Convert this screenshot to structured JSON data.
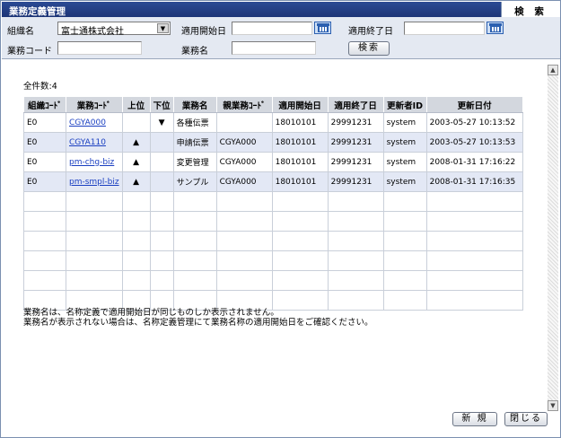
{
  "window": {
    "title": "業務定義管理",
    "tab": "検 索"
  },
  "search": {
    "org_label": "組織名",
    "org_value": "富士通株式会社",
    "start_label": "適用開始日",
    "start_value": "",
    "end_label": "適用終了日",
    "end_value": "",
    "code_label": "業務コード",
    "code_value": "",
    "name_label": "業務名",
    "name_value": "",
    "search_button": "検索"
  },
  "results": {
    "count_text": "全件数:4",
    "columns": [
      "組織ｺｰﾄﾞ",
      "業務ｺｰﾄﾞ",
      "上位",
      "下位",
      "業務名",
      "親業務ｺｰﾄﾞ",
      "適用開始日",
      "適用終了日",
      "更新者ID",
      "更新日付"
    ],
    "rows": [
      {
        "org": "E0",
        "code": "CGYA000",
        "upper": "",
        "lower": "▼",
        "name": "各種伝票",
        "parent": "",
        "start": "18010101",
        "end": "29991231",
        "user": "system",
        "updated": "2003-05-27 10:13:52"
      },
      {
        "org": "E0",
        "code": "CGYA110",
        "upper": "▲",
        "lower": "",
        "name": "申請伝票",
        "parent": "CGYA000",
        "start": "18010101",
        "end": "29991231",
        "user": "system",
        "updated": "2003-05-27 10:13:53"
      },
      {
        "org": "E0",
        "code": "pm-chg-biz",
        "upper": "▲",
        "lower": "",
        "name": "変更管理",
        "parent": "CGYA000",
        "start": "18010101",
        "end": "29991231",
        "user": "system",
        "updated": "2008-01-31 17:16:22"
      },
      {
        "org": "E0",
        "code": "pm-smpl-biz",
        "upper": "▲",
        "lower": "",
        "name": "サンプル",
        "parent": "CGYA000",
        "start": "18010101",
        "end": "29991231",
        "user": "system",
        "updated": "2008-01-31 17:16:35"
      }
    ],
    "empty_rows": 6,
    "note_line1": "業務名は、名称定義で適用開始日が同じものしか表示されません。",
    "note_line2": "業務名が表示されない場合は、名称定義管理にて業務名称の適用開始日をご確認ください。"
  },
  "footer": {
    "new_button": "新 規",
    "close_button": "閉じる"
  },
  "icons": {
    "calendar": "calendar-icon",
    "dropdown": "chevron-down-icon",
    "scroll_up": "scroll-up-icon",
    "scroll_down": "scroll-down-icon"
  },
  "colors": {
    "titlebar": "#1d3577",
    "panel": "#e4e9f2",
    "link": "#1a3fc1",
    "row_alt": "#e3e8f5",
    "header": "#d3d7de"
  }
}
